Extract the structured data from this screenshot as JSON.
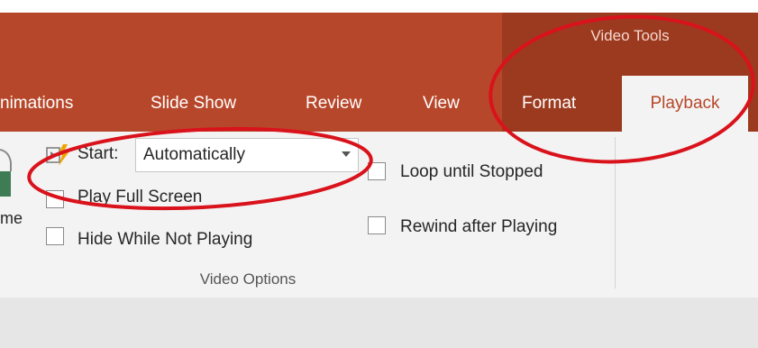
{
  "contextual": {
    "title": "Video Tools"
  },
  "tabs": [
    {
      "label": "nimations",
      "active": false
    },
    {
      "label": "Slide Show",
      "active": false
    },
    {
      "label": "Review",
      "active": false
    },
    {
      "label": "View",
      "active": false
    },
    {
      "label": "Format",
      "active": false
    },
    {
      "label": "Playback",
      "active": true
    }
  ],
  "ribbon": {
    "partial_label": "me",
    "start": {
      "label": "Start:",
      "value": "Automatically"
    },
    "checkboxes": {
      "play_full_screen": {
        "label": "Play Full Screen",
        "checked": false
      },
      "hide_while_not_playing": {
        "label": "Hide While Not Playing",
        "checked": false
      },
      "loop_until_stopped": {
        "label": "Loop until Stopped",
        "checked": false
      },
      "rewind_after_playing": {
        "label": "Rewind after Playing",
        "checked": false
      }
    },
    "group_label": "Video Options"
  },
  "colors": {
    "header": "#b7472a",
    "contextual_header": "#9c3a1f",
    "ribbon_bg": "#f3f3f3",
    "annotation": "#d9121b"
  },
  "icons": [
    "start-trigger-icon",
    "dropdown-arrow-icon",
    "partial-ribbon-icon"
  ]
}
